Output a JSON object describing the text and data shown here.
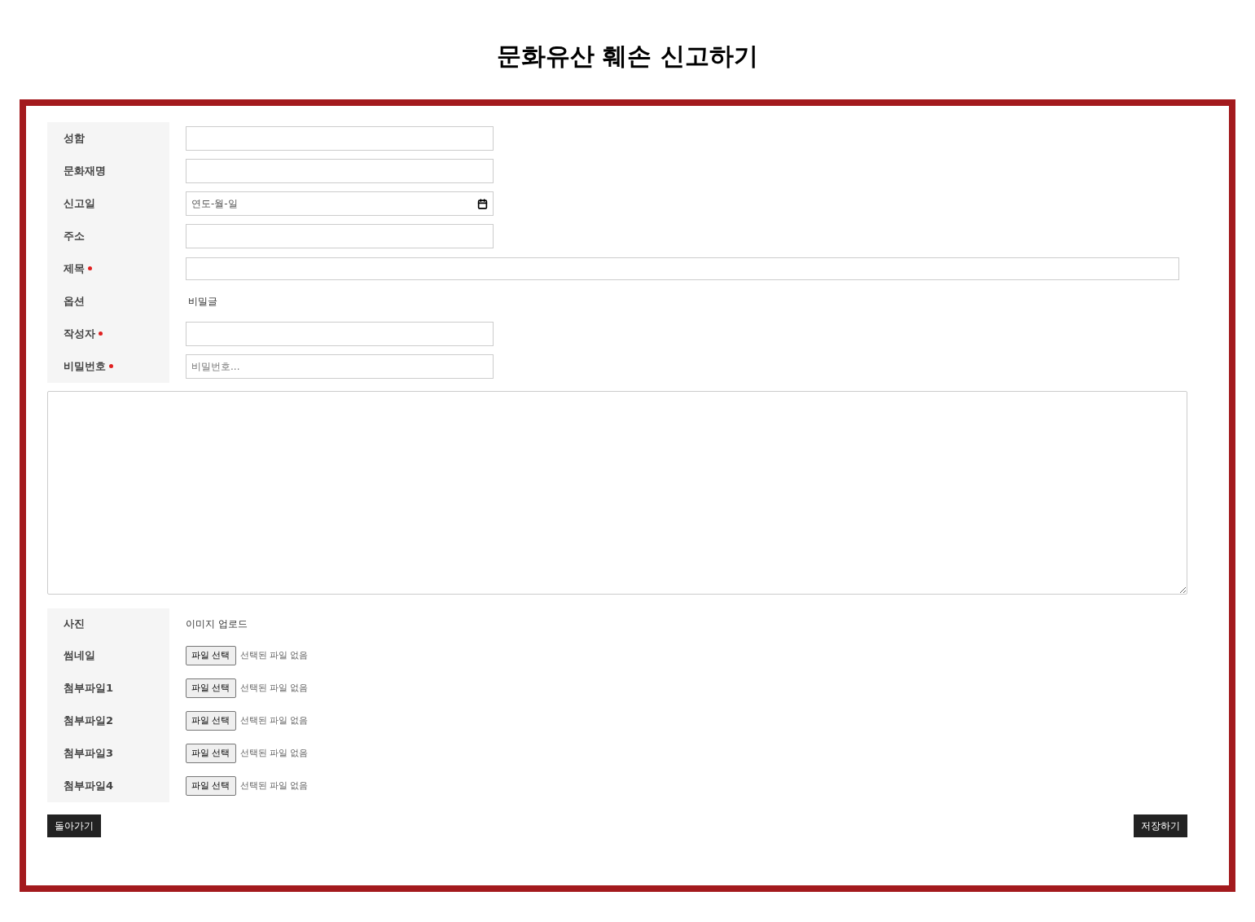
{
  "title": "문화유산 훼손 신고하기",
  "fields": [
    {
      "kind": "text",
      "label": "성함",
      "required": false
    },
    {
      "kind": "text",
      "label": "문화재명",
      "required": false
    },
    {
      "kind": "date",
      "label": "신고일",
      "required": false,
      "placeholder": "연도-월-일"
    },
    {
      "kind": "text",
      "label": "주소",
      "required": false
    },
    {
      "kind": "wide",
      "label": "제목",
      "required": true
    },
    {
      "kind": "option",
      "label": "옵션",
      "required": false,
      "option_label": "비밀글"
    },
    {
      "kind": "text",
      "label": "작성자",
      "required": true
    },
    {
      "kind": "text",
      "label": "비밀번호",
      "required": true,
      "placeholder": "비밀번호..."
    }
  ],
  "photo": {
    "label": "사진",
    "text": "이미지 업로드"
  },
  "files": [
    {
      "label": "썸네일",
      "button": "파일 선택",
      "status": "선택된 파일 없음"
    },
    {
      "label": "첨부파일1",
      "button": "파일 선택",
      "status": "선택된 파일 없음"
    },
    {
      "label": "첨부파일2",
      "button": "파일 선택",
      "status": "선택된 파일 없음"
    },
    {
      "label": "첨부파일3",
      "button": "파일 선택",
      "status": "선택된 파일 없음"
    },
    {
      "label": "첨부파일4",
      "button": "파일 선택",
      "status": "선택된 파일 없음"
    }
  ],
  "buttons": {
    "back": "돌아가기",
    "save": "저장하기"
  }
}
